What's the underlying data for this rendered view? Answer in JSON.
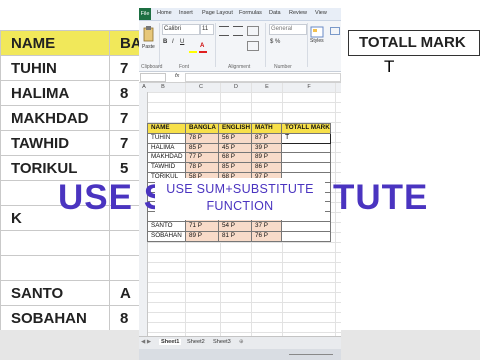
{
  "background": {
    "header": {
      "name": "NAME",
      "bangla_partial": "BA"
    },
    "rows": [
      {
        "name": "TUHIN",
        "v": "7"
      },
      {
        "name": "HALIMA",
        "v": "8"
      },
      {
        "name": "MAKHDAD",
        "v": "7"
      },
      {
        "name": "TAWHID",
        "v": "7"
      },
      {
        "name": "TORIKUL",
        "v": "5"
      },
      {
        "name": "",
        "v": ""
      },
      {
        "name": "K",
        "v": ""
      },
      {
        "name": "",
        "v": ""
      },
      {
        "name": "",
        "v": ""
      },
      {
        "name": "SANTO",
        "v": "A"
      },
      {
        "name": "SOBAHAN",
        "v": "8"
      }
    ],
    "total_header": "TOTALL MARK",
    "cursor_char": "T"
  },
  "ribbon": {
    "file": "File",
    "tabs": [
      "Home",
      "Insert",
      "Page Layout",
      "Formulas",
      "Data",
      "Review",
      "View"
    ],
    "font_name": "Calibri",
    "font_size": "11",
    "number_format": "General",
    "paste": "Paste",
    "bold": "B",
    "italic": "I",
    "underline": "U",
    "styles": "Styles",
    "groups": {
      "clipboard": "Clipboard",
      "font": "Font",
      "alignment": "Alignment",
      "number": "Number"
    }
  },
  "formula_bar": {
    "fx": "fx"
  },
  "columns": [
    "A",
    "B",
    "C",
    "D",
    "E",
    "F"
  ],
  "table": {
    "headers": [
      "NAME",
      "BANGLA",
      "ENGLISH",
      "MATH",
      "TOTALL MARK"
    ],
    "rows": [
      [
        "TUHIN",
        "78 P",
        "56 P",
        "87 P",
        "T"
      ],
      [
        "HALIMA",
        "85 P",
        "45 P",
        "39 P",
        ""
      ],
      [
        "MAKHDAD",
        "77 P",
        "68 P",
        "89 P",
        ""
      ],
      [
        "TAWHID",
        "78 P",
        "85 P",
        "86 P",
        ""
      ],
      [
        "TORIKUL",
        "58 P",
        "68 P",
        "97 P",
        ""
      ],
      [
        "",
        "",
        "",
        "",
        ""
      ],
      [
        "",
        "",
        "",
        "",
        ""
      ],
      [
        "",
        "",
        "",
        "",
        ""
      ],
      [
        "",
        "",
        "",
        "",
        ""
      ],
      [
        "SANTO",
        "71 P",
        "54 P",
        "37 P",
        ""
      ],
      [
        "SOBAHAN",
        "89 P",
        "81 P",
        "76 P",
        ""
      ]
    ]
  },
  "overlay": {
    "big_left": "USE S",
    "big_right": "TUTE",
    "line1": "USE SUM+SUBSTITUTE",
    "line2": "FUNCTION"
  },
  "sheets": [
    "Sheet1",
    "Sheet2",
    "Sheet3"
  ],
  "colors": {
    "accent_text": "#4a34c0",
    "header_fill": "#f7e04a",
    "value_fill": "#f8dbc9"
  }
}
